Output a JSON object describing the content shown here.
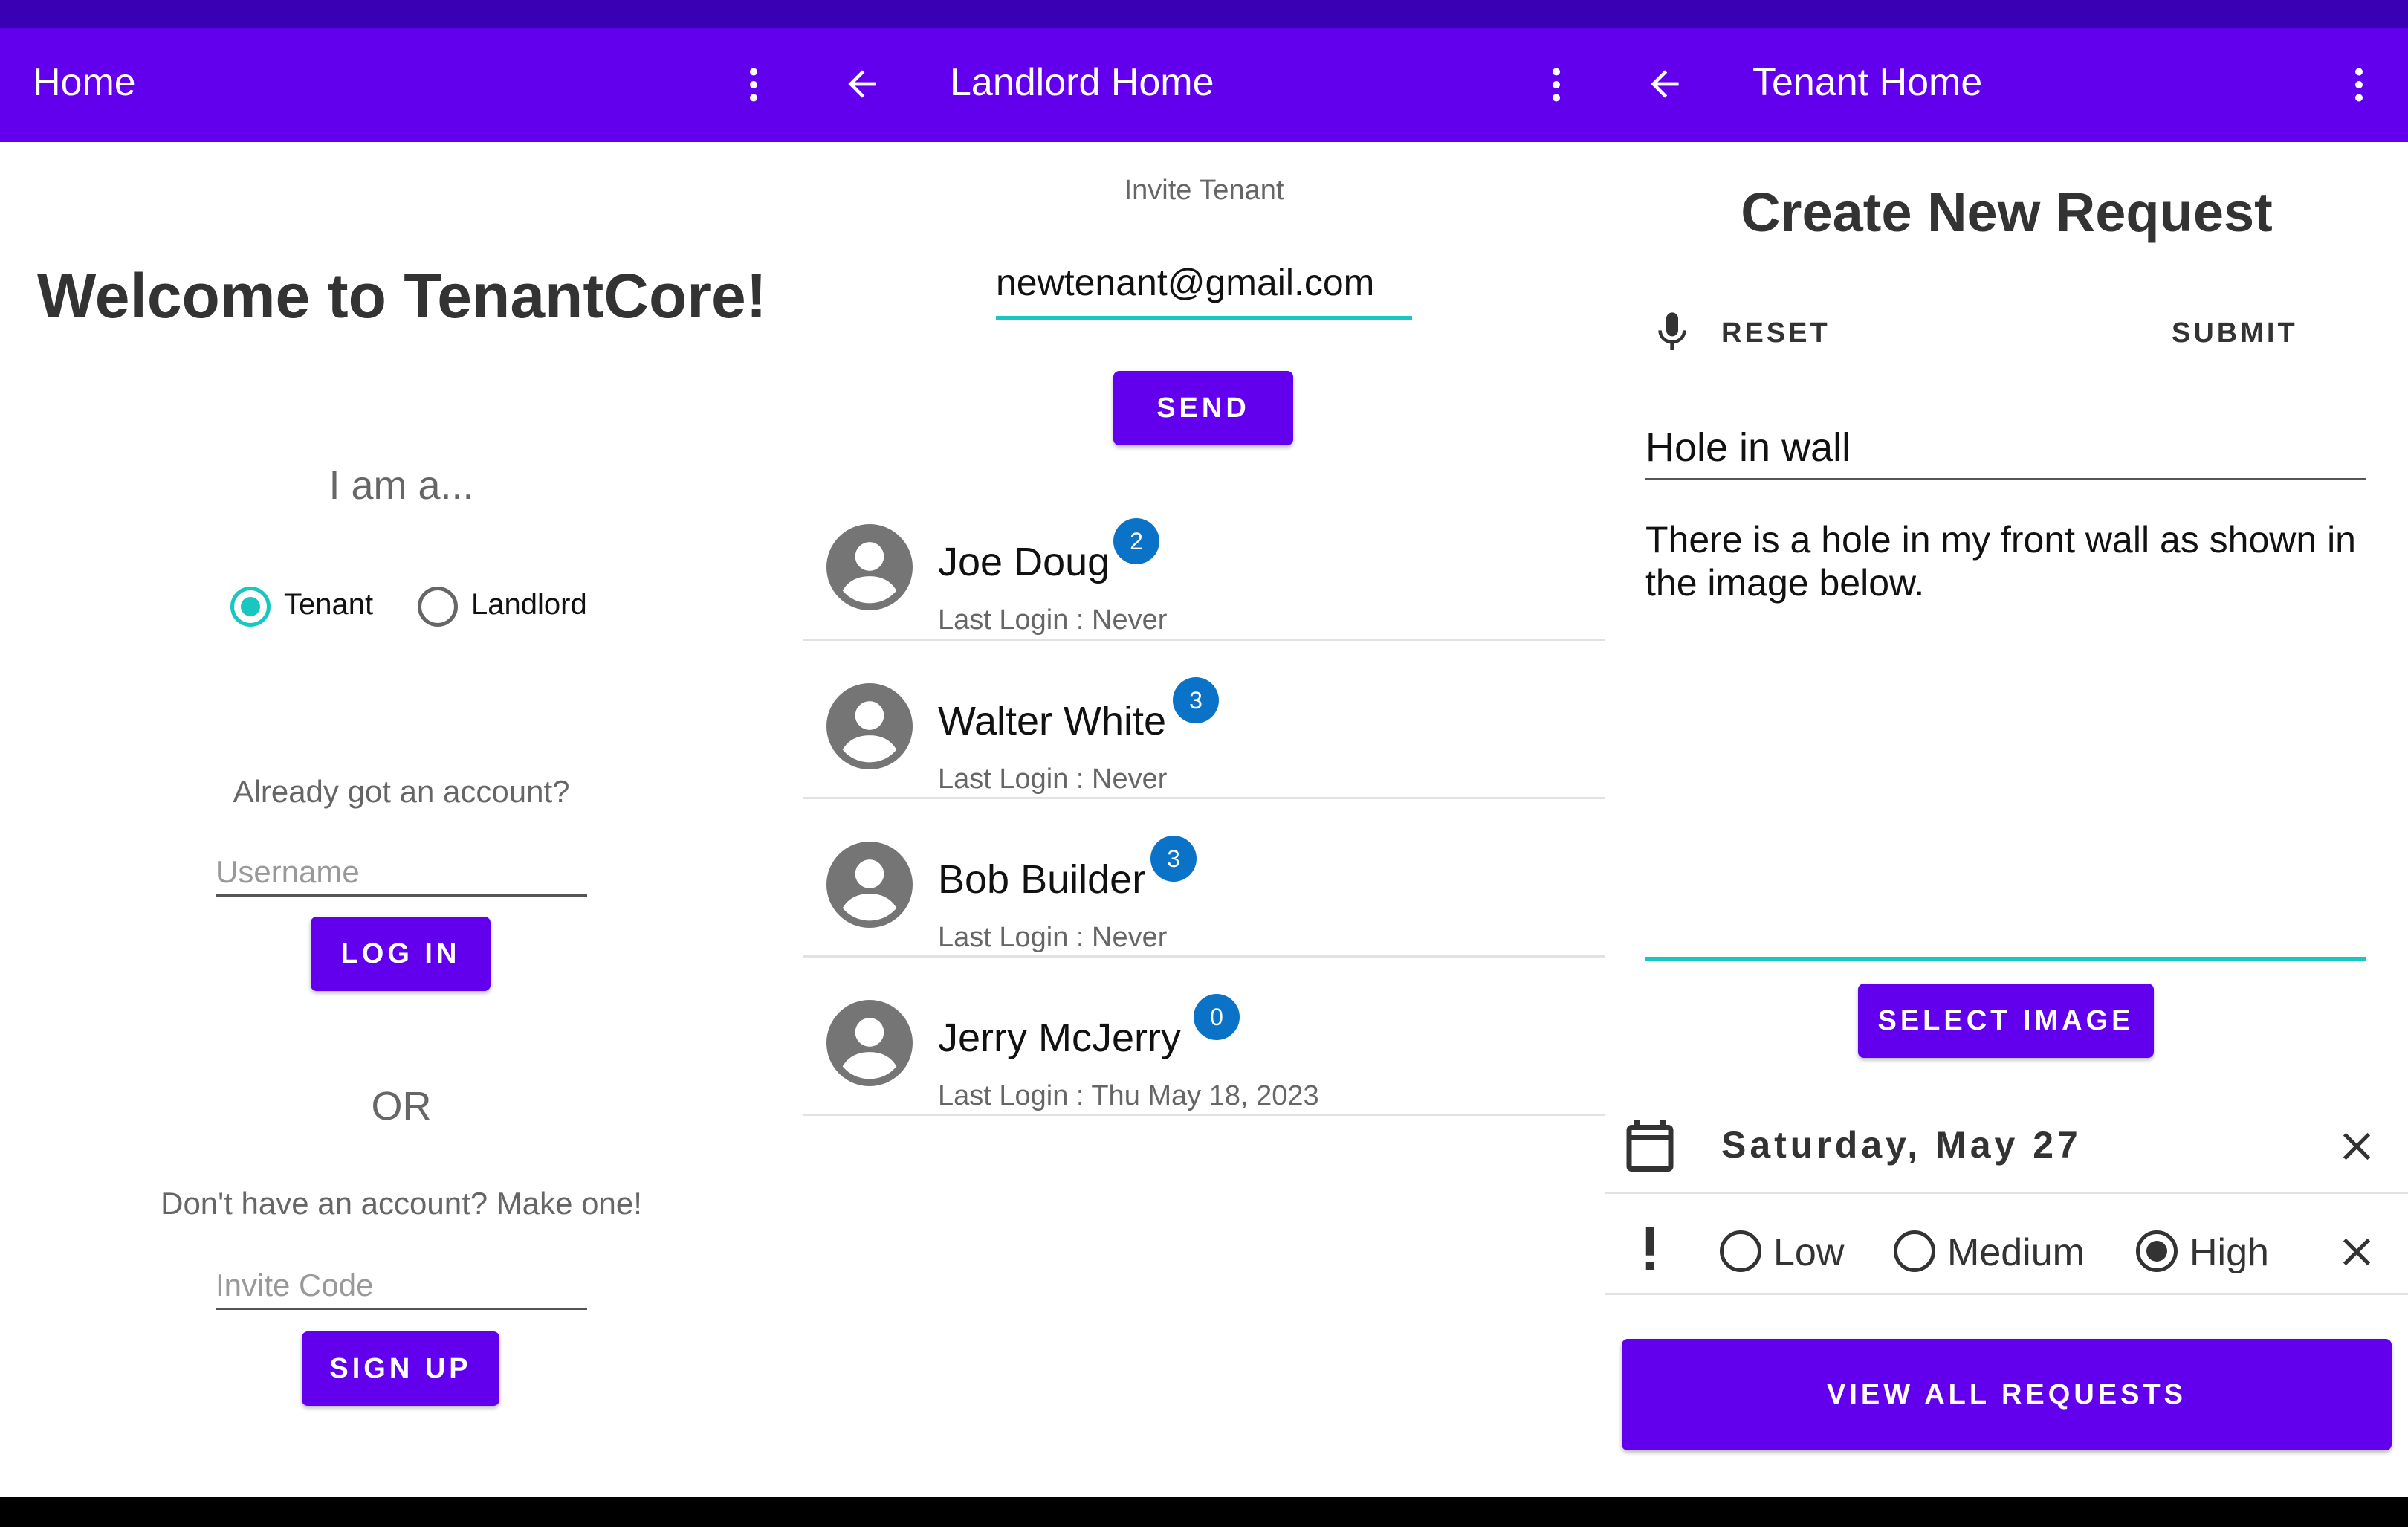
{
  "colors": {
    "primary": "#6200ee",
    "status_bar": "#3a00b4",
    "accent": "#18c8c0",
    "badge": "#0a73c8"
  },
  "home": {
    "app_bar": {
      "title": "Home",
      "more_icon": "more-vert-icon"
    },
    "welcome": "Welcome to TenantCore!",
    "role_prompt": "I am a...",
    "roles": [
      {
        "label": "Tenant",
        "selected": true
      },
      {
        "label": "Landlord",
        "selected": false
      }
    ],
    "login_prompt": "Already got an account?",
    "username_placeholder": "Username",
    "login_button": "LOG IN",
    "or_label": "OR",
    "signup_prompt": "Don't have an account? Make one!",
    "invite_code_placeholder": "Invite Code",
    "signup_button": "SIGN UP"
  },
  "landlord": {
    "app_bar": {
      "title": "Landlord Home",
      "back_icon": "arrow-back-icon",
      "more_icon": "more-vert-icon"
    },
    "invite_label": "Invite Tenant",
    "invite_email": "newtenant@gmail.com",
    "send_button": "SEND",
    "tenants": [
      {
        "name": "Joe Doug",
        "last_login": "Last Login : Never",
        "badge": "2"
      },
      {
        "name": "Walter White",
        "last_login": "Last Login : Never",
        "badge": "3"
      },
      {
        "name": "Bob Builder",
        "last_login": "Last Login : Never",
        "badge": "3"
      },
      {
        "name": "Jerry McJerry",
        "last_login": "Last Login : Thu May 18, 2023",
        "badge": "0"
      }
    ]
  },
  "tenant": {
    "app_bar": {
      "title": "Tenant Home",
      "back_icon": "arrow-back-icon",
      "more_icon": "more-vert-icon"
    },
    "heading": "Create New Request",
    "mic_icon": "microphone-icon",
    "reset_button": "RESET",
    "submit_button": "SUBMIT",
    "request_title": "Hole in wall",
    "request_description": "There is a hole in my front wall as shown in the image below.",
    "select_image_button": "SELECT IMAGE",
    "date_icon": "calendar-icon",
    "date_value": "Saturday, May 27",
    "priority_icon": "exclamation-icon",
    "priorities": [
      {
        "label": "Low",
        "selected": false
      },
      {
        "label": "Medium",
        "selected": false
      },
      {
        "label": "High",
        "selected": true
      }
    ],
    "view_all_button": "VIEW ALL REQUESTS"
  }
}
